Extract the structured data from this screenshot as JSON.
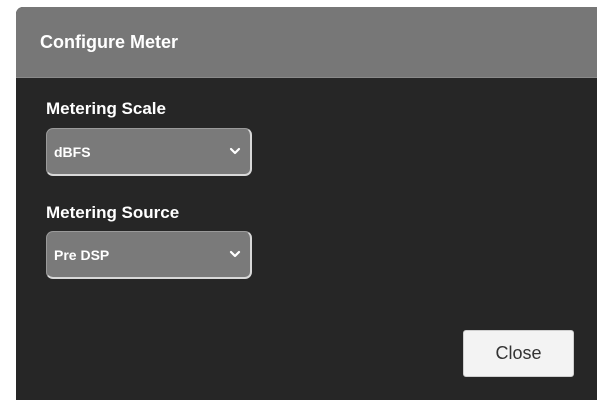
{
  "dialog": {
    "title": "Configure Meter",
    "scale_label": "Metering Scale",
    "scale_value": "dBFS",
    "source_label": "Metering Source",
    "source_value": "Pre DSP",
    "close_label": "Close"
  },
  "icons": {
    "dropdown": "chevron-down-icon"
  },
  "colors": {
    "dialog_bg": "#262626",
    "titlebar_bg": "#777777",
    "select_bg": "#7a7a7a",
    "button_bg": "#f3f3f3"
  }
}
